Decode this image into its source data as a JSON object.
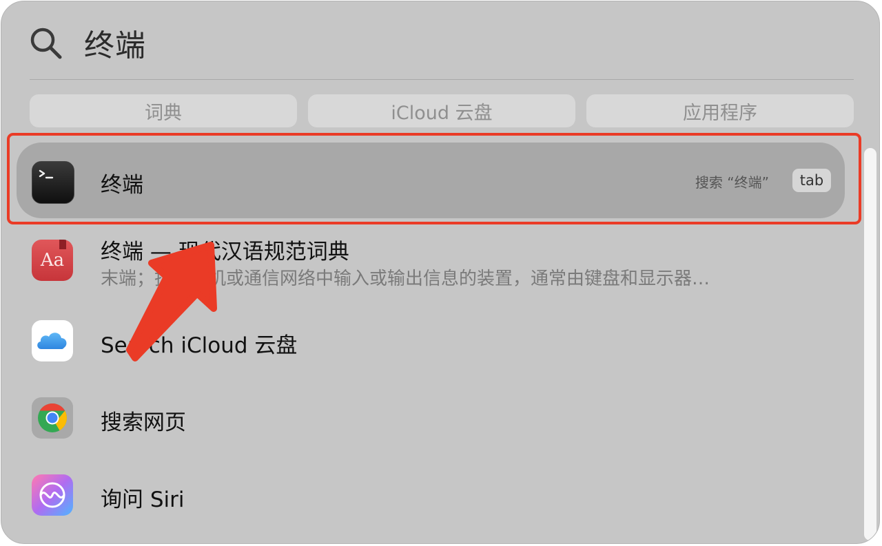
{
  "search": {
    "query": "终端",
    "icon": "magnifier-icon"
  },
  "filters": [
    {
      "label": "词典"
    },
    {
      "label": "iCloud 云盘"
    },
    {
      "label": "应用程序"
    }
  ],
  "results": [
    {
      "title": "终端",
      "icon": "terminal-icon",
      "hint": "搜索 “终端”",
      "shortcut": "tab",
      "selected": true
    },
    {
      "title": "终端 — 现代汉语规范词典",
      "subtitle": "末端；指计算机或通信网络中输入或输出信息的装置，通常由键盘和显示器…",
      "icon": "dictionary-icon",
      "icon_text": "Aa"
    },
    {
      "title": "Search iCloud 云盘",
      "icon": "icloud-icon"
    },
    {
      "title": "搜索网页",
      "icon": "chrome-icon"
    },
    {
      "title": "询问 Siri",
      "icon": "siri-icon"
    }
  ],
  "colors": {
    "panel_bg": "#c6c6c6",
    "selected_row_bg": "#a8a8a8",
    "annotation_red": "#ea3b26"
  }
}
